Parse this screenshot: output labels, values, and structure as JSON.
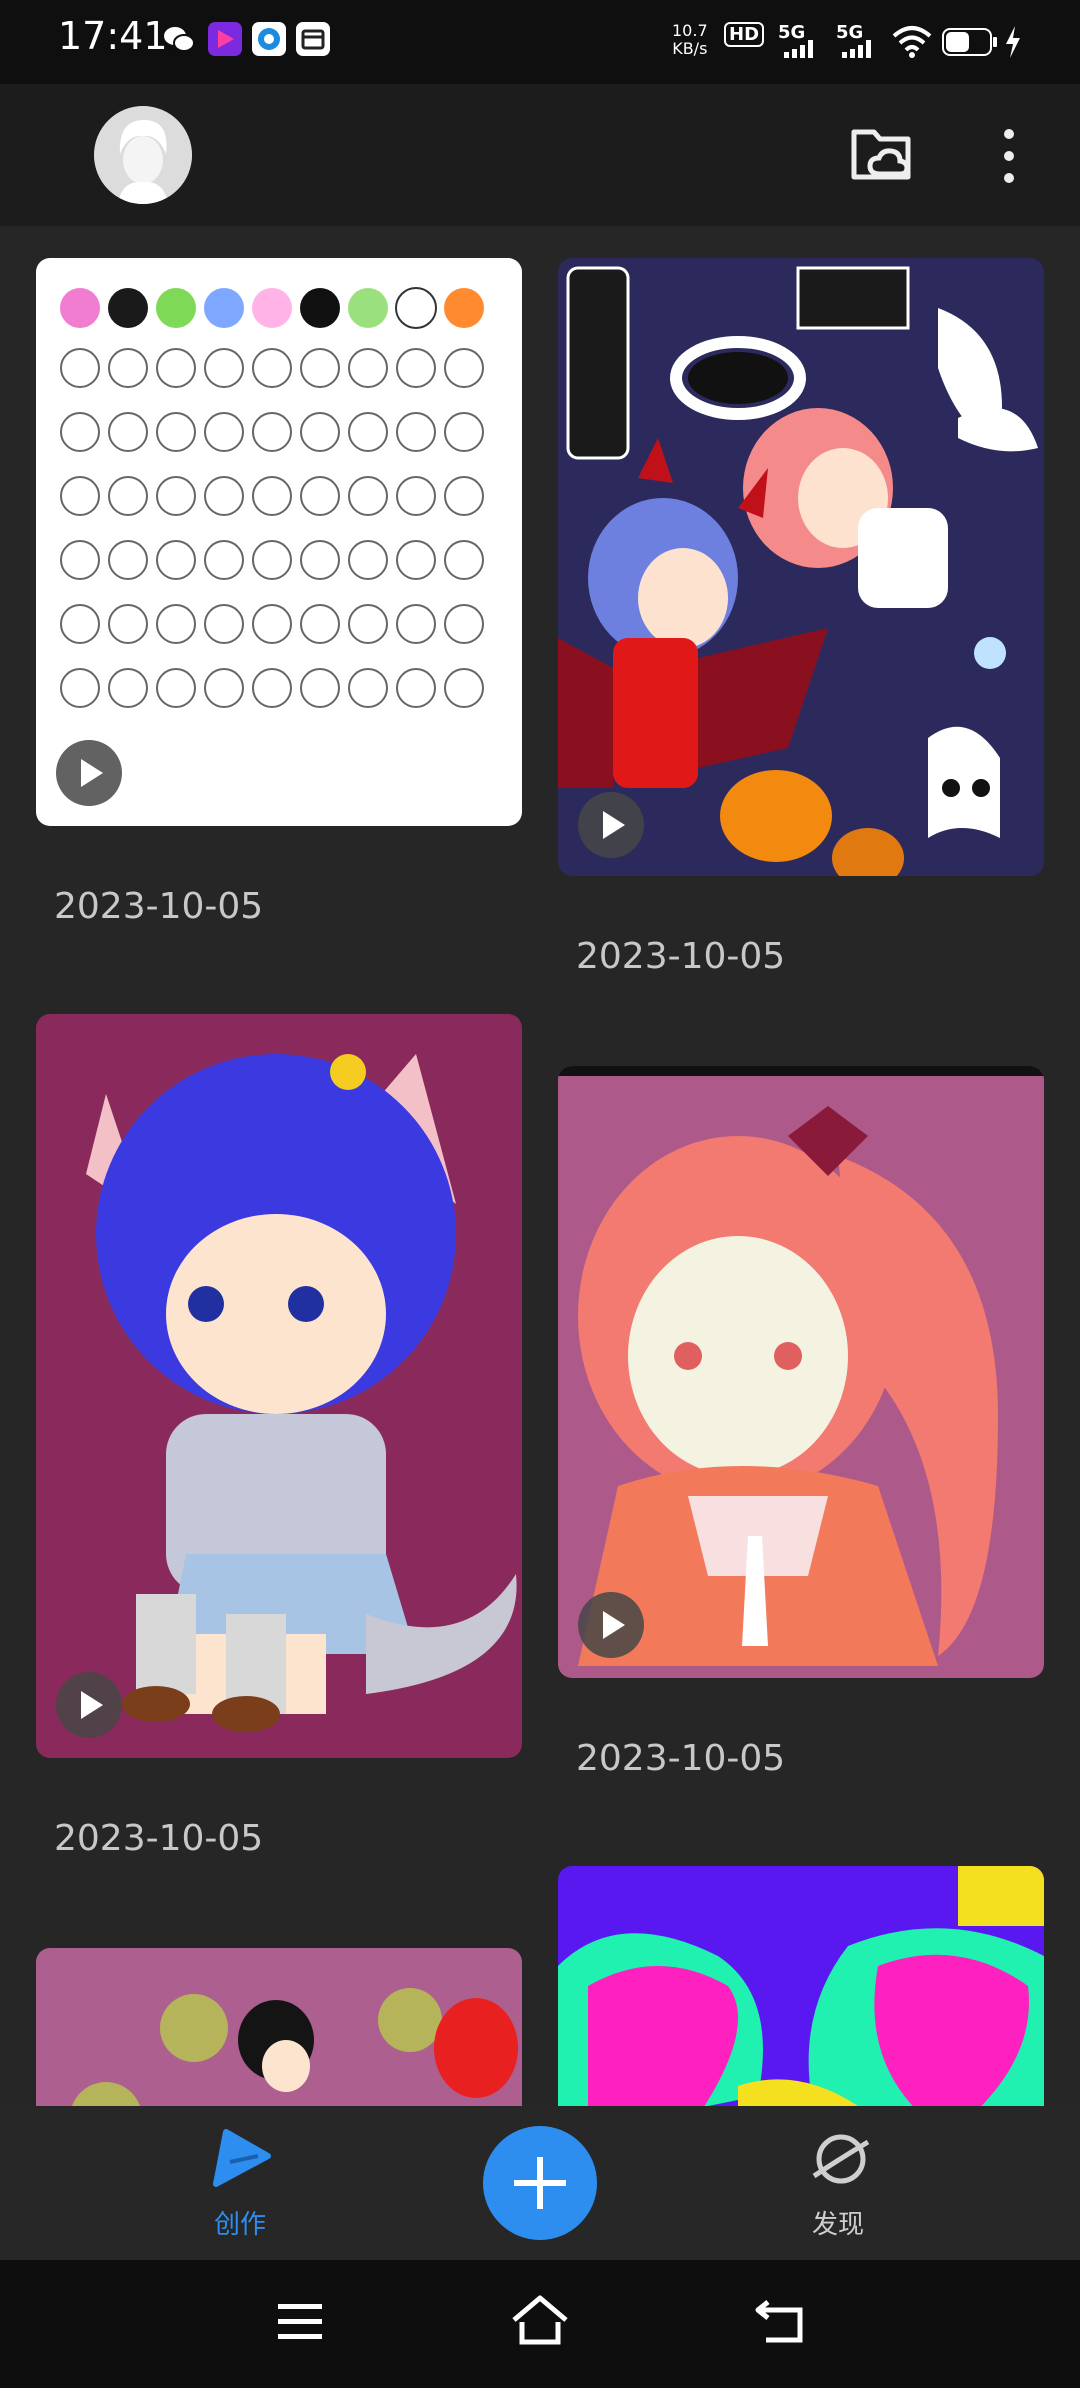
{
  "status_bar": {
    "time": "17:41",
    "net_speed_value": "10.7",
    "net_speed_unit": "KB/s",
    "hd_label": "HD",
    "sim1": "5G",
    "sim2": "5G",
    "battery_level": 0.55,
    "icons": [
      "wechat-icon",
      "app-purple-icon",
      "app-blue-icon",
      "app-box-icon",
      "wifi-icon",
      "battery-icon",
      "charging-icon"
    ]
  },
  "header": {
    "icons": [
      "avatar-icon",
      "folder-cloud-icon",
      "more-vert-icon"
    ]
  },
  "gallery": {
    "items": [
      {
        "date": "2023-10-05",
        "thumb": "head-template-grid"
      },
      {
        "date": "2023-10-05",
        "thumb": "angel-and-devil-halloween"
      },
      {
        "date": "2023-10-05",
        "thumb": "blue-hair-cat-girl"
      },
      {
        "date": "2023-10-05",
        "thumb": "pink-ponytail-girl"
      },
      {
        "thumb": "girl-with-dots"
      },
      {
        "thumb": "neon-hearts"
      }
    ]
  },
  "bottom_nav": {
    "create_label": "创作",
    "discover_label": "发现",
    "active_color": "#2d8ef0"
  },
  "system_nav": {
    "icons": [
      "menu-icon",
      "home-icon",
      "back-icon"
    ]
  }
}
